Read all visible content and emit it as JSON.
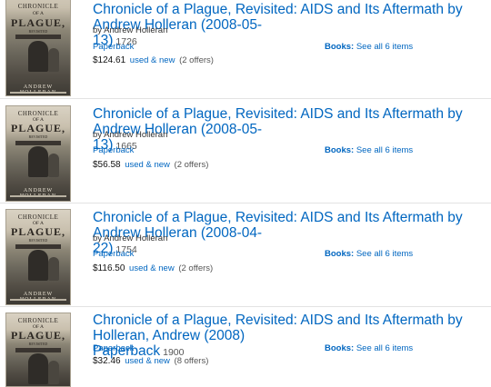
{
  "results": [
    {
      "title_line1": "Chronicle of a Plague, Revisited: AIDS and Its Aftermath by Andrew Holleran (2008-05-",
      "title_line2": "13)",
      "number": "1726",
      "byline": "by Andrew Holleran",
      "format": "Paperback",
      "price": "$124.61",
      "used_new": "used & new",
      "offers": "(2 offers)",
      "books_label": "Books:",
      "see_all": "See all 6 items"
    },
    {
      "title_line1": "Chronicle of a Plague, Revisited: AIDS and Its Aftermath by Andrew Holleran (2008-05-",
      "title_line2": "13)",
      "number": "1665",
      "byline": "by Andrew Holleran",
      "format": "Paperback",
      "price": "$56.58",
      "used_new": "used & new",
      "offers": "(2 offers)",
      "books_label": "Books:",
      "see_all": "See all 6 items"
    },
    {
      "title_line1": "Chronicle of a Plague, Revisited: AIDS and Its Aftermath by Andrew Holleran (2008-04-",
      "title_line2": "22)",
      "number": "1754",
      "byline": "by Andrew Holleran",
      "format": "Paperback",
      "price": "$116.50",
      "used_new": "used & new",
      "offers": "(2 offers)",
      "books_label": "Books:",
      "see_all": "See all 6 items"
    },
    {
      "title_line1": "Chronicle of a Plague, Revisited: AIDS and Its Aftermath by Holleran, Andrew (2008)",
      "title_line2": "Paperback",
      "number": "1900",
      "format": "Paperback",
      "price": "$32.46",
      "used_new": "used & new",
      "offers": "(8 offers)",
      "books_label": "Books:",
      "see_all": "See all 6 items"
    }
  ],
  "cover": {
    "line1": "CHRONICLE",
    "line2": "OF A",
    "line3": "PLAGUE,",
    "line4": "REVISITED",
    "author": "ANDREW HOLLERAN"
  },
  "colors": {
    "link": "#0066c0",
    "text": "#333333",
    "divider": "#e3e3e3"
  }
}
